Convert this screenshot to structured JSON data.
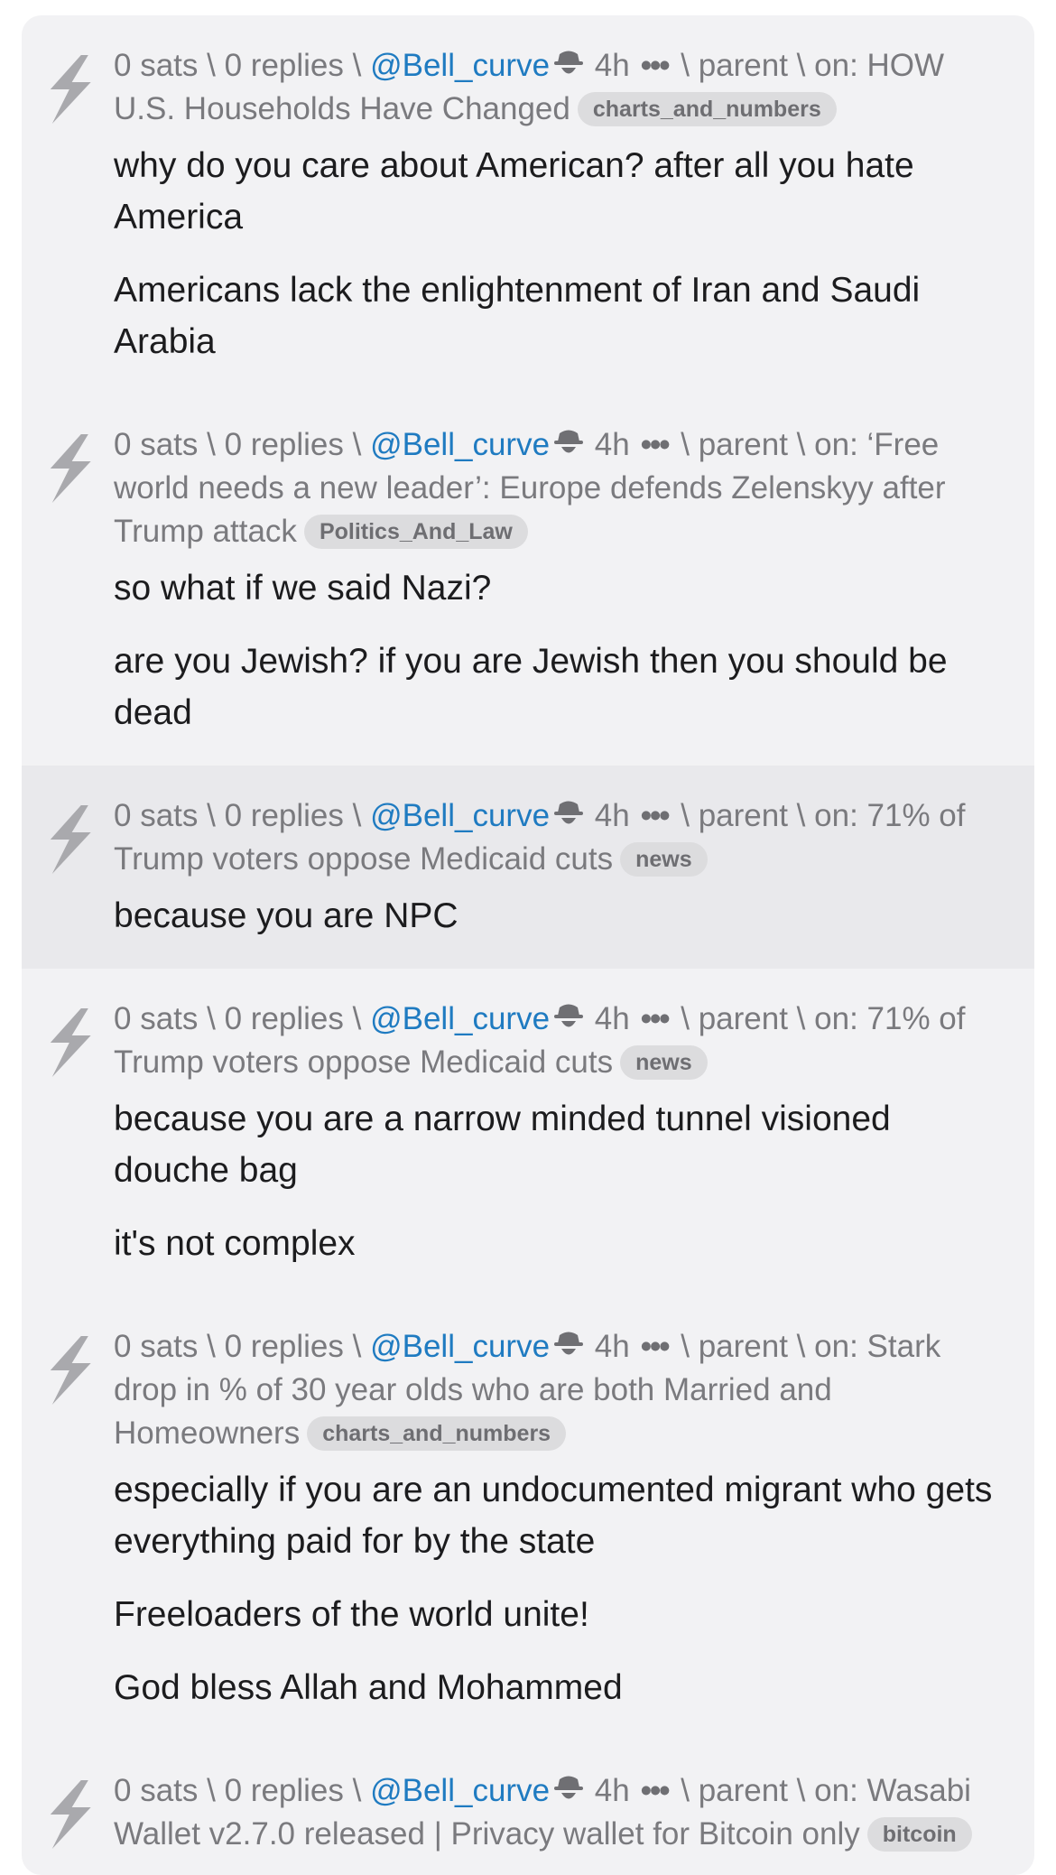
{
  "comments": [
    {
      "sats": "0 sats",
      "replies": "0 replies",
      "sep": "\\",
      "user": "@Bell_curve",
      "age": "4h",
      "dots": "•••",
      "parent": "parent",
      "on": "on:",
      "title": "HOW U.S. Households Have Changed",
      "tag": "charts_and_numbers",
      "paragraphs": [
        "why do you care about American?  after all you hate America",
        "Americans lack the enlightenment of Iran and Saudi Arabia"
      ]
    },
    {
      "sats": "0 sats",
      "replies": "0 replies",
      "sep": "\\",
      "user": "@Bell_curve",
      "age": "4h",
      "dots": "•••",
      "parent": "parent",
      "on": "on:",
      "title": "‘Free world needs a new leader’: Europe defends Zelenskyy after Trump attack",
      "tag": "Politics_And_Law",
      "paragraphs": [
        "so what if we said Nazi?",
        "are you Jewish?  if you are Jewish then you should be dead"
      ]
    },
    {
      "sats": "0 sats",
      "replies": "0 replies",
      "sep": "\\",
      "user": "@Bell_curve",
      "age": "4h",
      "dots": "•••",
      "parent": "parent",
      "on": "on:",
      "title": "71% of Trump voters oppose Medicaid cuts",
      "tag": "news",
      "highlighted": true,
      "paragraphs": [
        "because you are NPC"
      ]
    },
    {
      "sats": "0 sats",
      "replies": "0 replies",
      "sep": "\\",
      "user": "@Bell_curve",
      "age": "4h",
      "dots": "•••",
      "parent": "parent",
      "on": "on:",
      "title": "71% of Trump voters oppose Medicaid cuts",
      "tag": "news",
      "paragraphs": [
        "because you are a narrow minded tunnel visioned douche bag",
        "it's not complex"
      ]
    },
    {
      "sats": "0 sats",
      "replies": "0 replies",
      "sep": "\\",
      "user": "@Bell_curve",
      "age": "4h",
      "dots": "•••",
      "parent": "parent",
      "on": "on:",
      "title": "Stark drop in % of 30 year olds who are both Married and Homeowners",
      "tag": "charts_and_numbers",
      "paragraphs": [
        "especially if you are an undocumented migrant who gets everything paid for by the state",
        "Freeloaders of the world unite!",
        "God bless Allah and Mohammed"
      ]
    },
    {
      "sats": "0 sats",
      "replies": "0 replies",
      "sep": "\\",
      "user": "@Bell_curve",
      "age": "4h",
      "dots": "•••",
      "parent": "parent",
      "on": "on:",
      "title": "Wasabi Wallet v2.7.0 released | Privacy wallet for Bitcoin only",
      "tag": "bitcoin",
      "paragraphs": []
    }
  ],
  "icons": {
    "zap": "lightning-bolt-icon",
    "spy": "incognito-spy-icon"
  },
  "colors": {
    "user_link": "#1f7bc1",
    "meta_text": "#7a7a7e",
    "card_bg": "#f2f2f4",
    "highlight_bg": "#e9e9ec",
    "tag_bg": "#dcdcde",
    "body_text": "#1c1c1e",
    "zap_icon": "#a9a9ad"
  }
}
